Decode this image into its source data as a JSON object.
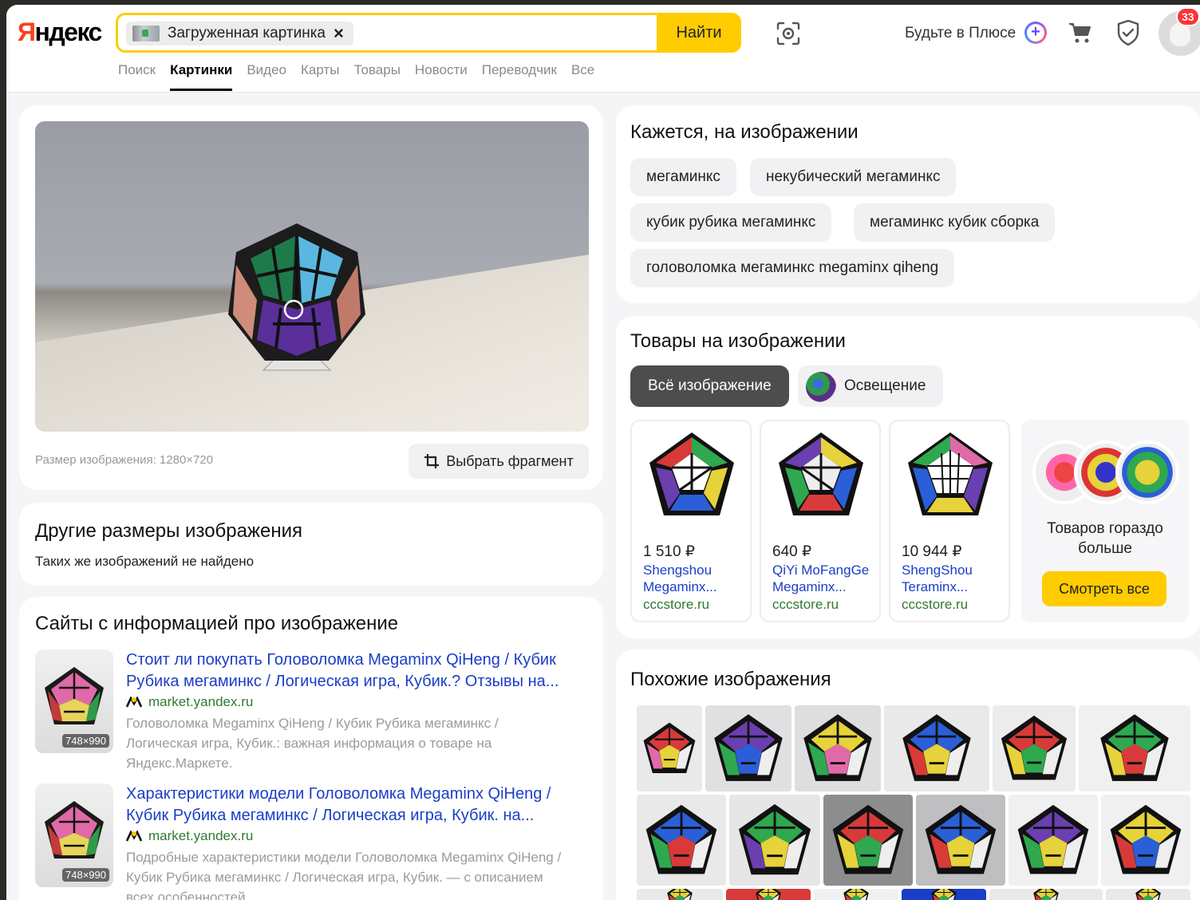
{
  "header": {
    "logo": "Яндекс",
    "search_chip_label": "Загруженная картинка",
    "search_chip_remove": "×",
    "search_button": "Найти",
    "plus_label": "Будьте в Плюсе",
    "notifications_count": "33"
  },
  "tabs": [
    {
      "label": "Поиск",
      "active": false
    },
    {
      "label": "Картинки",
      "active": true
    },
    {
      "label": "Видео",
      "active": false
    },
    {
      "label": "Карты",
      "active": false
    },
    {
      "label": "Товары",
      "active": false
    },
    {
      "label": "Новости",
      "active": false
    },
    {
      "label": "Переводчик",
      "active": false
    },
    {
      "label": "Все",
      "active": false
    }
  ],
  "preview": {
    "image_size_text": "Размер изображения: 1280×720",
    "select_fragment_button": "Выбрать фрагмент"
  },
  "other_sizes": {
    "title": "Другие размеры изображения",
    "text": "Таких же изображений не найдено"
  },
  "sites": {
    "title": "Сайты с информацией про изображение",
    "items": [
      {
        "thumb_dim": "748×990",
        "title": "Стоит ли покупать Головоломка Megaminx QiHeng / Кубик Рубика мегаминкс / Логическая игра, Кубик.? Отзывы на...",
        "domain": "market.yandex.ru",
        "description": "Головоломка Megaminx QiHeng / Кубик Рубика мегаминкс / Логическая игра, Кубик.: важная информация о товаре на Яндекс.Маркете."
      },
      {
        "thumb_dim": "748×990",
        "title": "Характеристики модели Головоломка Megaminx QiHeng / Кубик Рубика мегаминкс / Логическая игра, Кубик. на...",
        "domain": "market.yandex.ru",
        "description": "Подробные характеристики модели Головоломка Megaminx QiHeng / Кубик Рубика мегаминкс / Логическая игра, Кубик. — с описанием всех особенностей."
      }
    ]
  },
  "looks_like": {
    "title": "Кажется, на изображении",
    "tags": [
      "мегаминкс",
      "некубический мегаминкс",
      "кубик рубика мегаминкс",
      "мегаминкс кубик сборка",
      "головоломка мегаминкс megaminx qiheng"
    ]
  },
  "goods": {
    "title": "Товары на изображении",
    "filters": [
      "Всё изображение",
      "Освещение"
    ],
    "products": [
      {
        "price": "1 510 ₽",
        "name": "Shengshou Megaminx...",
        "shop": "cccstore.ru"
      },
      {
        "price": "640 ₽",
        "name": "QiYi MoFangGe Megaminx...",
        "shop": "cccstore.ru"
      },
      {
        "price": "10 944 ₽",
        "name": "ShengShou Teraminx...",
        "shop": "cccstore.ru"
      }
    ],
    "more_text": "Товаров гораздо больше",
    "more_button": "Смотреть все"
  },
  "similar": {
    "title": "Похожие изображения"
  },
  "colors": {
    "accent_yellow": "#ffcc00",
    "link_blue": "#1a3ec8",
    "domain_green": "#2f7a2f",
    "logo_red": "#fc3f1d"
  }
}
